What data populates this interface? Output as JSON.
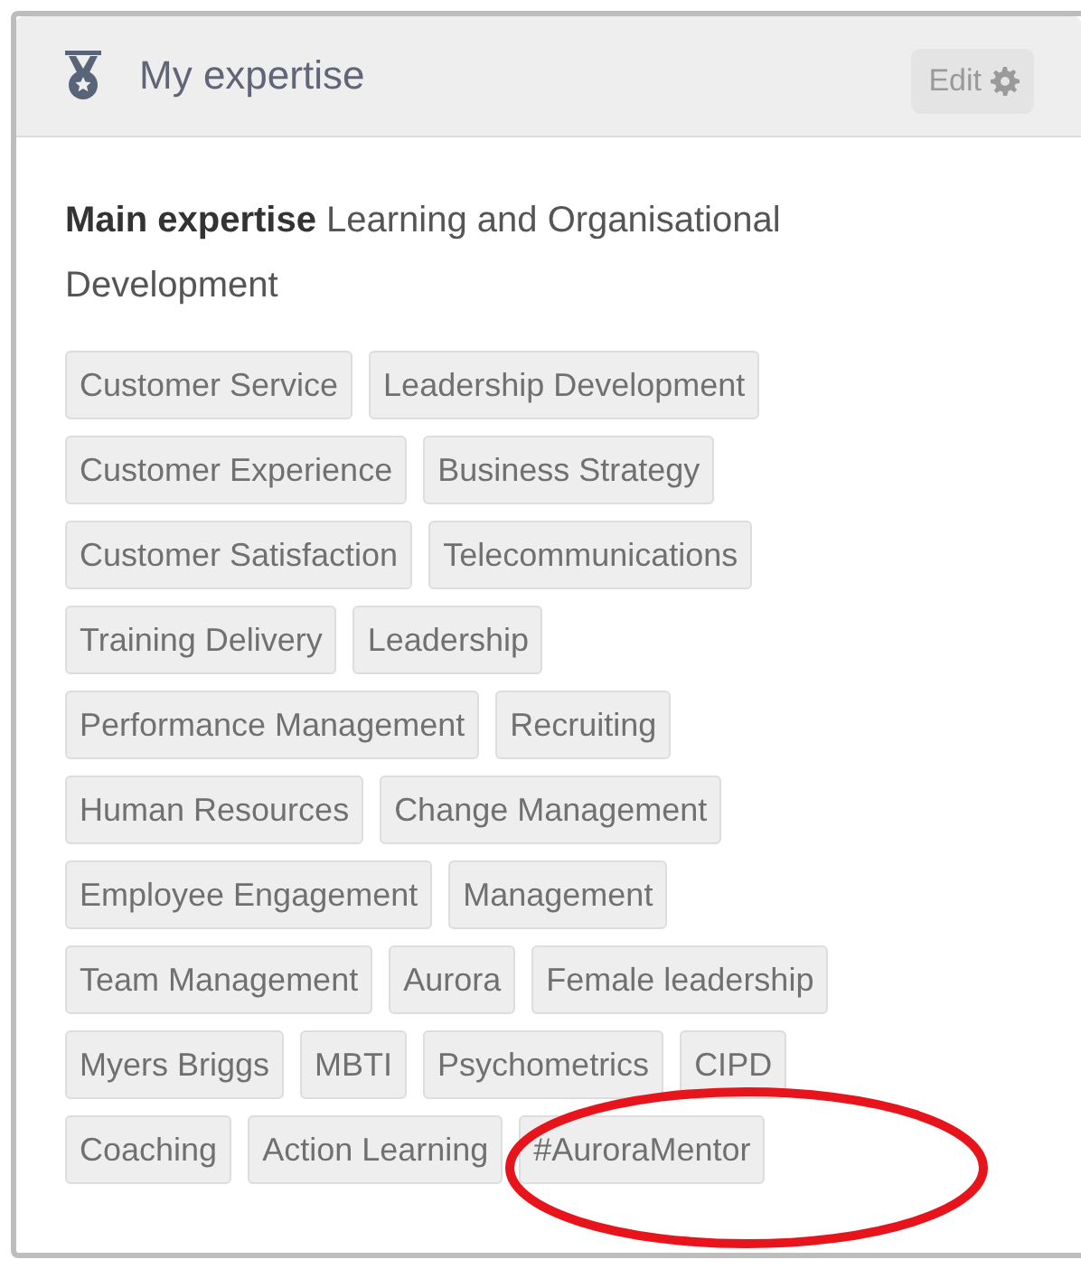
{
  "panel": {
    "title": "My expertise",
    "edit_button": "Edit"
  },
  "main_expertise": {
    "label": "Main expertise",
    "value": "Learning and Organisational Development"
  },
  "tag_rows": [
    [
      "Customer Service",
      "Leadership Development"
    ],
    [
      "Customer Experience",
      "Business Strategy"
    ],
    [
      "Customer Satisfaction",
      "Telecommunications"
    ],
    [
      "Training Delivery",
      "Leadership"
    ],
    [
      "Performance Management",
      "Recruiting"
    ],
    [
      "Human Resources",
      "Change Management"
    ],
    [
      "Employee Engagement",
      "Management"
    ],
    [
      "Team Management",
      "Aurora",
      "Female leadership"
    ],
    [
      "Myers Briggs",
      "MBTI",
      "Psychometrics",
      "CIPD"
    ],
    [
      "Coaching",
      "Action Learning",
      "#AuroraMentor"
    ]
  ]
}
